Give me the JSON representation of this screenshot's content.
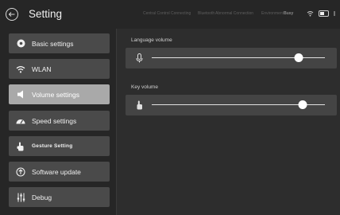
{
  "header": {
    "title": "Setting",
    "status": {
      "control_text": "Central Control Connecting",
      "ble_text": "Bluetooth",
      "connection_text": "Abnormal Connection",
      "environment_label": "Environment",
      "environment_value": "Busy"
    }
  },
  "sidebar": {
    "items": [
      {
        "label": "Basic settings",
        "icon": "basic-settings-icon"
      },
      {
        "label": "WLAN",
        "icon": "wifi-icon"
      },
      {
        "label": "Volume settings",
        "icon": "speaker-icon",
        "active": true
      },
      {
        "label": "Speed settings",
        "icon": "speedometer-icon"
      },
      {
        "label": "Gesture Setting",
        "icon": "gesture-hand-icon"
      },
      {
        "label": "Software update",
        "icon": "update-icon"
      },
      {
        "label": "Debug",
        "icon": "debug-sliders-icon"
      }
    ]
  },
  "content": {
    "language_volume": {
      "label": "Language volume",
      "level": 0.85
    },
    "key_volume": {
      "label": "Key volume",
      "level": 0.87
    }
  }
}
